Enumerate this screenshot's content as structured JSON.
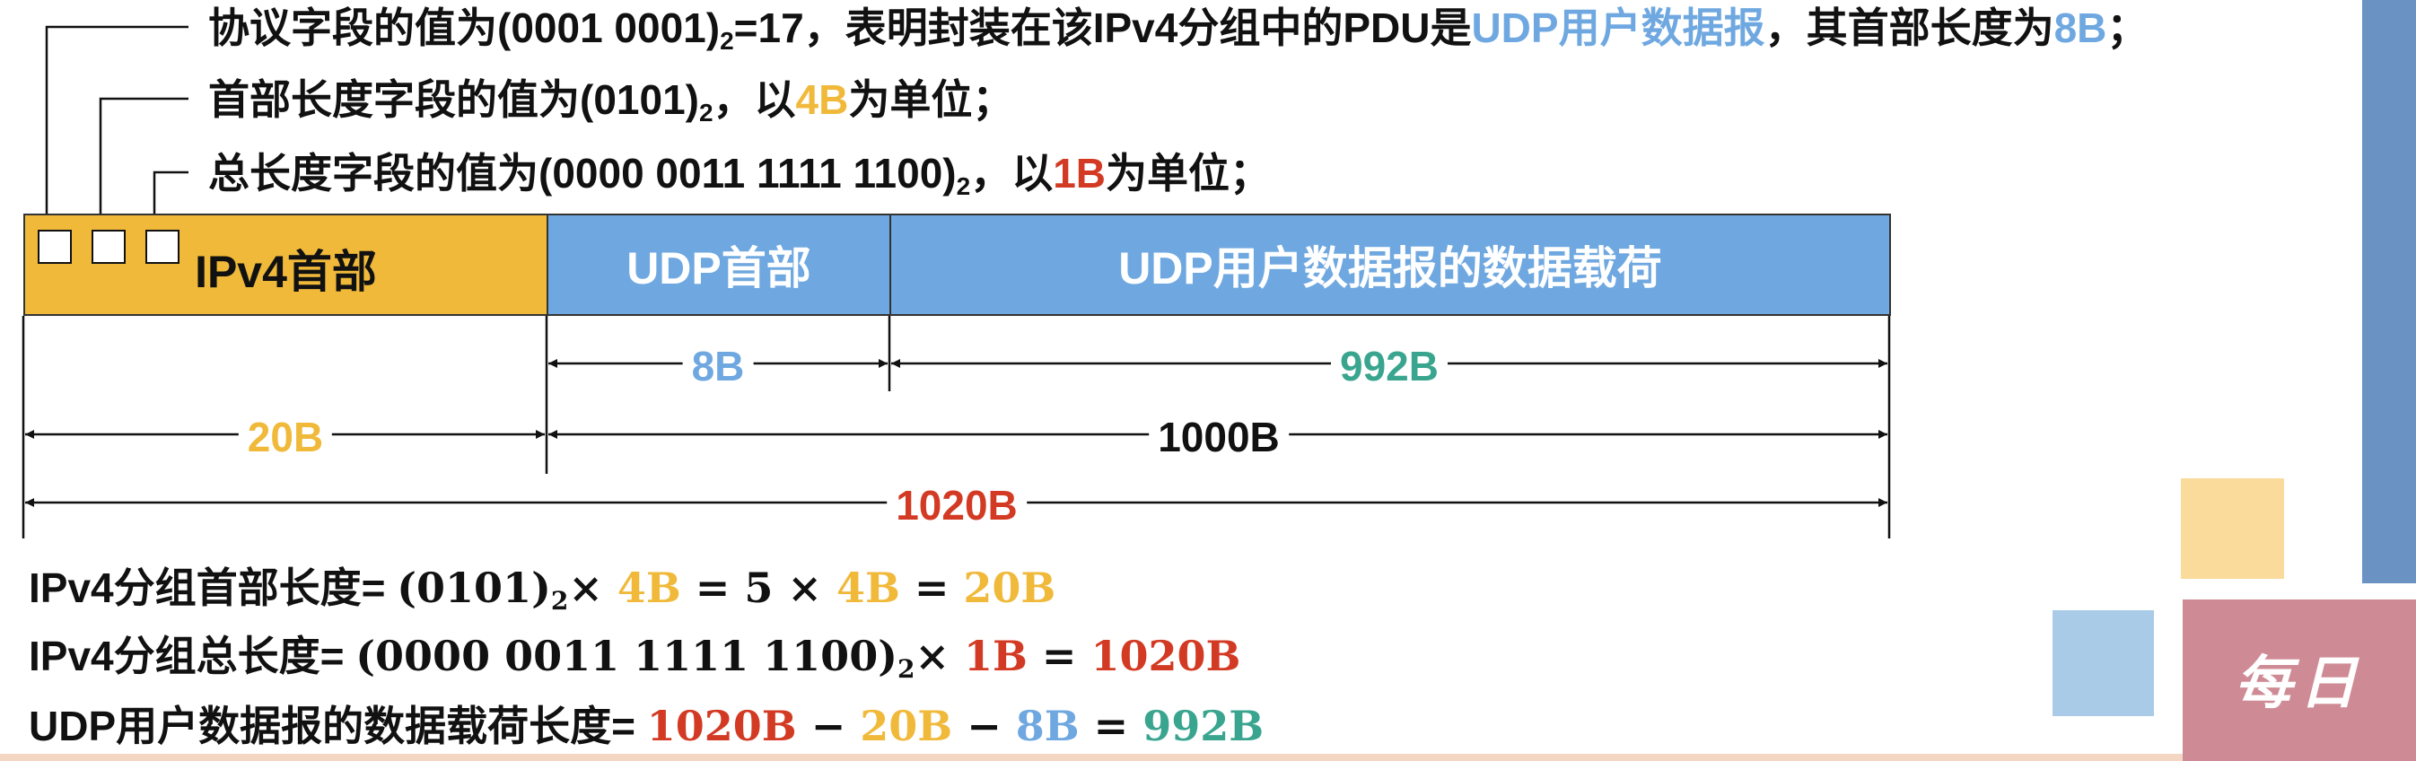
{
  "annotations": {
    "protocol": {
      "prefix": "协议字段的值为(0001 0001)",
      "sub": "2",
      "mid": "=17，表明封装在该IPv4分组中的PDU是",
      "highlight": "UDP用户数据报",
      "mid2": "，其首部长度为",
      "highlight2": "8B",
      "suffix": "；"
    },
    "header_len": {
      "prefix": "首部长度字段的值为(0101)",
      "sub": "2",
      "mid": "，以",
      "highlight": "4B",
      "suffix": "为单位；"
    },
    "total_len": {
      "prefix": "总长度字段的值为(0000 0011 1111 1100)",
      "sub": "2",
      "mid": "，以",
      "highlight": "1B",
      "suffix": "为单位；"
    }
  },
  "segments": {
    "ipv4_header": "IPv4首部",
    "udp_header": "UDP首部",
    "udp_payload": "UDP用户数据报的数据载荷"
  },
  "dimensions": {
    "udp_header_size": "8B",
    "payload_size": "992B",
    "ipv4_header_size": "20B",
    "udp_total_size": "1000B",
    "ipv4_total_size": "1020B"
  },
  "formulas": {
    "f1": {
      "label": "IPv4分组首部长度=",
      "expr1": "(0101)",
      "sub": "2",
      "times": "×",
      "a": "4B",
      "eq1": "= 5 ×",
      "b": "4B",
      "eq2": "=",
      "c": "20B"
    },
    "f2": {
      "label": "IPv4分组总长度=",
      "expr1": "(0000 0011 1111 1100)",
      "sub": "2",
      "times": "×",
      "a": "1B",
      "eq1": "=",
      "b": "1020B"
    },
    "f3": {
      "label": "UDP用户数据报的数据载荷长度=",
      "a": "1020B",
      "m1": "−",
      "b": "20B",
      "m2": "−",
      "c": "8B",
      "eq": "=",
      "d": "992B"
    }
  },
  "side_panel": {
    "text": "每日"
  },
  "colors": {
    "yellow": "#f0b93a",
    "blue": "#6fa8e0",
    "red": "#d33a24",
    "teal": "#3aa58f",
    "side_blue": "#6a93c4",
    "side_pink": "#cf8b95"
  }
}
